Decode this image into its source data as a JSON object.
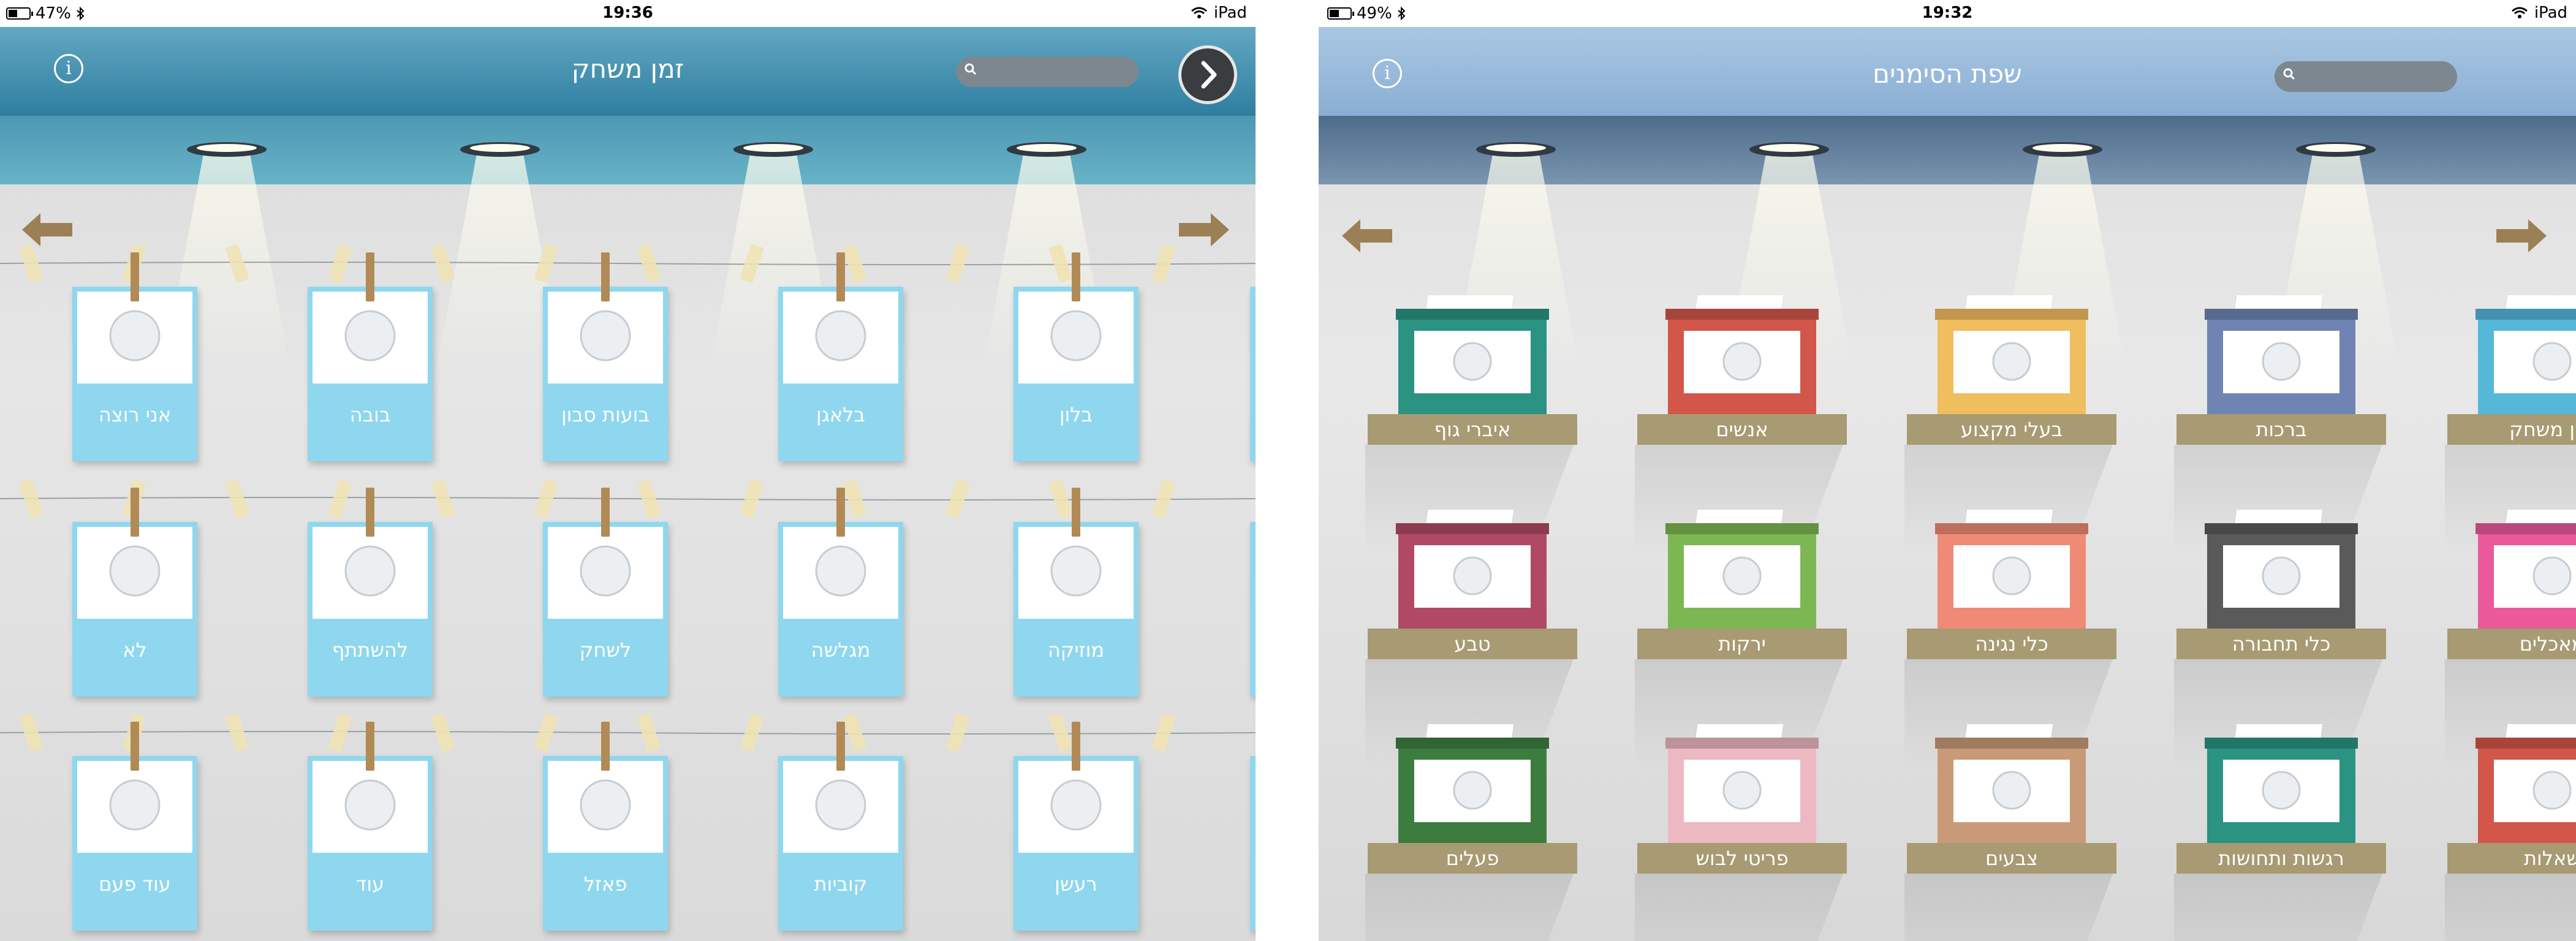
{
  "left_screen": {
    "status": {
      "battery": "47%",
      "time": "19:36",
      "device": "iPad"
    },
    "header": {
      "title": "זמן משחק"
    },
    "rows": [
      [
        "אני רוצה",
        "בובה",
        "בועות סבון",
        "בלאגן",
        "בלון"
      ],
      [
        "לא",
        "להשתתף",
        "לשחק",
        "מגלשה",
        "מוזיקה"
      ],
      [
        "עוד פעם",
        "עוד",
        "פאזל",
        "קוביות",
        "רעשן"
      ]
    ],
    "icons": {
      "info": "info-icon",
      "search": "search-icon",
      "next": "chevron-right-icon",
      "back_arrow": "arrow-left-icon",
      "forward_arrow": "arrow-right-icon"
    }
  },
  "right_screen": {
    "status": {
      "battery": "49%",
      "time": "19:32",
      "device": "iPad"
    },
    "header": {
      "title": "שפת הסימנים"
    },
    "rows": [
      [
        "איברי גוף",
        "אנשים",
        "בעלי מקצוע",
        "ברכות",
        "זמן משחק"
      ],
      [
        "טבע",
        "ירקות",
        "כלי נגינה",
        "כלי תחבורה",
        "מאכלים"
      ],
      [
        "פעלים",
        "פריטי לבוש",
        "צבעים",
        "רגשות ותחושות",
        "שאלות"
      ]
    ],
    "box_colors": [
      [
        "#2a9382",
        "#d2564a",
        "#f0bd5f",
        "#6f84b3",
        "#55b8d9"
      ],
      [
        "#b04a64",
        "#7cb751",
        "#ef8a76",
        "#5a5a5a",
        "#ea5a9b"
      ],
      [
        "#3c7d3f",
        "#ecb8c1",
        "#c99a78",
        "#2a9382",
        "#d2564a"
      ]
    ]
  },
  "colors": {
    "card_blue": "#8fd7ee",
    "shelf_tan": "#a89a72",
    "left_header": "#3f8db0",
    "right_header": "#9fbedd"
  }
}
